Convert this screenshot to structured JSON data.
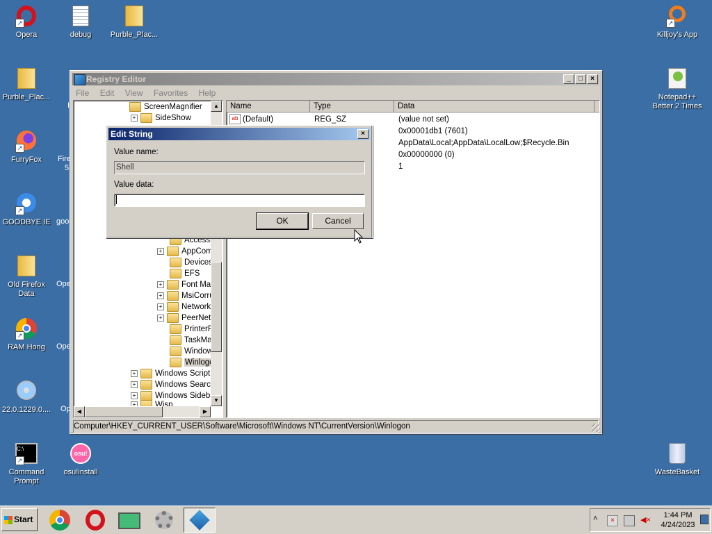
{
  "desktop": {
    "icons": [
      {
        "label": "Opera"
      },
      {
        "label": "debug"
      },
      {
        "label": "Purble_Plac..."
      },
      {
        "label": "Killjoy's App"
      },
      {
        "label": "Purble_Plac..."
      },
      {
        "label": "Notepad++ Better 2 Times"
      },
      {
        "label": "FurryFox"
      },
      {
        "label": "GOODBYE IE"
      },
      {
        "label": "Old Firefox Data"
      },
      {
        "label": "RAM Hong"
      },
      {
        "label": "22.0.1229.0...."
      },
      {
        "label": "Command Prompt"
      },
      {
        "label": "osu!install"
      },
      {
        "label": "WasteBasket"
      }
    ],
    "partial_labels": [
      "Fire",
      "5",
      "goo",
      "Ope",
      "Ope",
      "Op",
      "I"
    ]
  },
  "regedit": {
    "title": "Registry Editor",
    "menu": [
      "File",
      "Edit",
      "View",
      "Favorites",
      "Help"
    ],
    "tree": [
      {
        "label": "ScreenMagnifier",
        "expander": ""
      },
      {
        "label": "SideShow",
        "expander": "+"
      },
      {
        "label": "Accessib",
        "expander": ""
      },
      {
        "label": "AppCom",
        "expander": "+"
      },
      {
        "label": "Devices",
        "expander": ""
      },
      {
        "label": "EFS",
        "expander": ""
      },
      {
        "label": "Font Ma",
        "expander": "+"
      },
      {
        "label": "MsiCorru",
        "expander": "+"
      },
      {
        "label": "Network",
        "expander": "+"
      },
      {
        "label": "PeerNet",
        "expander": "+"
      },
      {
        "label": "PrinterP",
        "expander": ""
      },
      {
        "label": "TaskMan",
        "expander": ""
      },
      {
        "label": "Windows",
        "expander": ""
      },
      {
        "label": "Winlogon",
        "expander": ""
      },
      {
        "label": "Windows Script",
        "expander": "+"
      },
      {
        "label": "Windows Search",
        "expander": "+"
      },
      {
        "label": "Windows Sideba",
        "expander": "+"
      },
      {
        "label": "Wisp",
        "expander": "+"
      }
    ],
    "columns": {
      "name": "Name",
      "type": "Type",
      "data": "Data"
    },
    "rows": [
      {
        "name": "(Default)",
        "type": "REG_SZ",
        "data": "(value not set)"
      },
      {
        "name": "",
        "type": "",
        "data": "0x00001db1 (7601)"
      },
      {
        "name": "",
        "type": "",
        "data": "AppData\\Local;AppData\\LocalLow;$Recycle.Bin"
      },
      {
        "name": "",
        "type": "",
        "data": "0x00000000 (0)"
      },
      {
        "name": "",
        "type": "",
        "data": "1"
      }
    ],
    "statusbar": "Computer\\HKEY_CURRENT_USER\\Software\\Microsoft\\Windows NT\\CurrentVersion\\Winlogon"
  },
  "dialog": {
    "title": "Edit String",
    "value_name_label": "Value name:",
    "value_name": "Shell",
    "value_data_label": "Value data:",
    "value_data": "",
    "ok": "OK",
    "cancel": "Cancel"
  },
  "taskbar": {
    "start": "Start",
    "time": "1:44 PM",
    "date": "4/24/2023"
  },
  "colors": {
    "desktop": "#3a6ea5",
    "titlebar_active": "#0a246a",
    "chrome": "#d4d0c8"
  }
}
